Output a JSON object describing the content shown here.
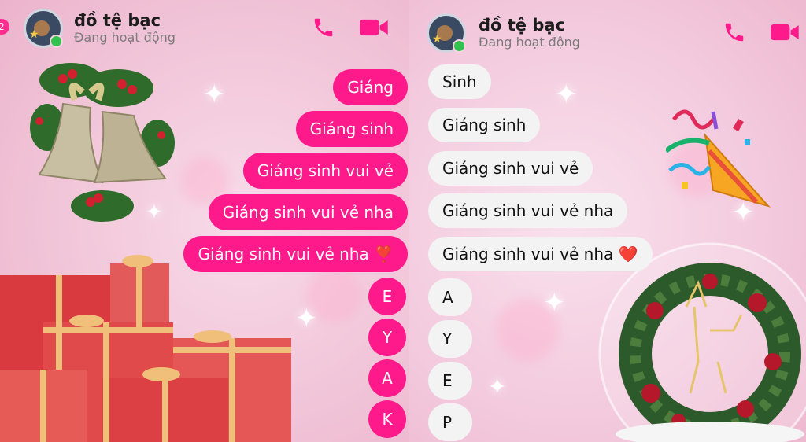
{
  "left_chat": {
    "unread_badge": "2",
    "contact_name": "đồ tệ bạc",
    "status": "Đang hoạt động",
    "messages": [
      {
        "text": "Giáng"
      },
      {
        "text": "Giáng sinh"
      },
      {
        "text": "Giáng sinh vui vẻ"
      },
      {
        "text": "Giáng sinh vui vẻ nha"
      },
      {
        "text": "Giáng sinh vui vẻ nha ❣️"
      },
      {
        "text": "E"
      },
      {
        "text": "Y"
      },
      {
        "text": "A"
      },
      {
        "text": "K"
      }
    ]
  },
  "right_chat": {
    "contact_name": "đồ tệ bạc",
    "status": "Đang hoạt động",
    "messages": [
      {
        "text": "Sinh"
      },
      {
        "text": "Giáng sinh"
      },
      {
        "text": "Giáng sinh vui vẻ"
      },
      {
        "text": "Giáng sinh vui vẻ nha"
      },
      {
        "text": "Giáng sinh vui vẻ nha ❤️"
      },
      {
        "text": "A"
      },
      {
        "text": "Y"
      },
      {
        "text": "E"
      },
      {
        "text": "P"
      }
    ]
  },
  "icons": {
    "call": "phone-icon",
    "video": "video-camera-icon"
  },
  "colors": {
    "outgoing_bubble": "#ff1a8c",
    "incoming_bubble": "#f3f3f3",
    "accent": "#ff2d8f",
    "online_dot": "#31c24d"
  }
}
